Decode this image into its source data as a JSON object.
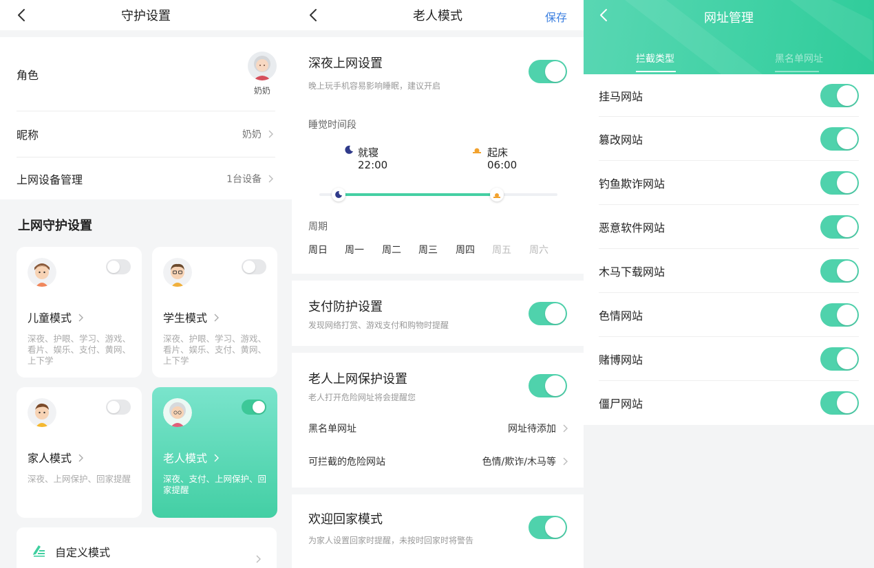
{
  "screen1": {
    "title": "守护设置",
    "role_label": "角色",
    "role_avatar_name": "奶奶",
    "nickname_label": "昵称",
    "nickname_value": "奶奶",
    "device_label": "上网设备管理",
    "device_value": "1台设备",
    "section_title": "上网守护设置",
    "modes": [
      {
        "name": "儿童模式",
        "desc": "深夜、护眼、学习、游戏、看片、娱乐、支付、黄网、上下学",
        "enabled": false,
        "icon": "child-avatar-icon"
      },
      {
        "name": "学生模式",
        "desc": "深夜、护眼、学习、游戏、看片、娱乐、支付、黄网、上下学",
        "enabled": false,
        "icon": "student-avatar-icon"
      },
      {
        "name": "家人模式",
        "desc": "深夜、上网保护、回家提醒",
        "enabled": false,
        "icon": "family-avatar-icon"
      },
      {
        "name": "老人模式",
        "desc": "深夜、支付、上网保护、回家提醒",
        "enabled": true,
        "icon": "elder-avatar-icon"
      }
    ],
    "custom_label": "自定义模式",
    "accent": "#43cfa4"
  },
  "screen2": {
    "title": "老人模式",
    "save_label": "保存",
    "night": {
      "title": "深夜上网设置",
      "subtitle": "晚上玩手机容易影响睡眠，建议开启",
      "enabled": true
    },
    "sleep_period_label": "睡觉时间段",
    "bedtime_label": "就寝",
    "bedtime_value": "22:00",
    "wake_label": "起床",
    "wake_value": "06:00",
    "period_label": "周期",
    "days": [
      {
        "label": "周日",
        "selected": true
      },
      {
        "label": "周一",
        "selected": true
      },
      {
        "label": "周二",
        "selected": true
      },
      {
        "label": "周三",
        "selected": true
      },
      {
        "label": "周四",
        "selected": true
      },
      {
        "label": "周五",
        "selected": false
      },
      {
        "label": "周六",
        "selected": false
      }
    ],
    "payment": {
      "title": "支付防护设置",
      "subtitle": "发现网络打赏、游戏支付和购物时提醒",
      "enabled": true
    },
    "elder": {
      "title": "老人上网保护设置",
      "subtitle": "老人打开危险网址将会提醒您",
      "enabled": true
    },
    "blacklist_label": "黑名单网址",
    "blacklist_value": "网址待添加",
    "blockable_label": "可拦截的危险网站",
    "blockable_value": "色情/欺诈/木马等",
    "home": {
      "title": "欢迎回家模式",
      "subtitle": "为家人设置回家时提醒，未按时回家时将警告",
      "enabled": true
    }
  },
  "screen3": {
    "title": "网址管理",
    "tabs": [
      "拦截类型",
      "黑名单网址"
    ],
    "active_tab": 0,
    "categories": [
      {
        "label": "挂马网站",
        "enabled": true
      },
      {
        "label": "篡改网站",
        "enabled": true
      },
      {
        "label": "钓鱼欺诈网站",
        "enabled": true
      },
      {
        "label": "恶意软件网站",
        "enabled": true
      },
      {
        "label": "木马下载网站",
        "enabled": true
      },
      {
        "label": "色情网站",
        "enabled": true
      },
      {
        "label": "赌博网站",
        "enabled": true
      },
      {
        "label": "僵尸网站",
        "enabled": true
      }
    ]
  }
}
